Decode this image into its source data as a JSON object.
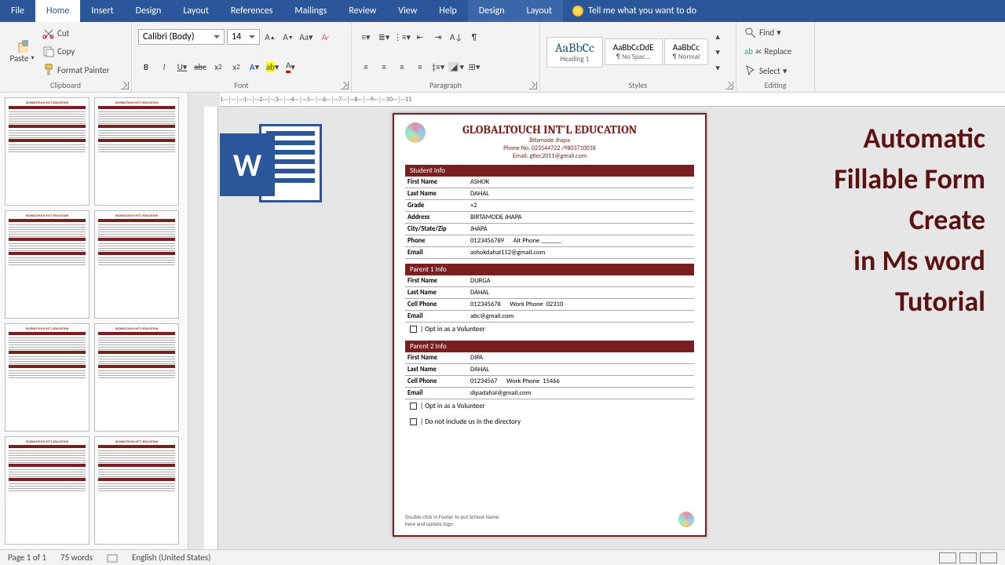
{
  "tabs": [
    "File",
    "Home",
    "Insert",
    "Design",
    "Layout",
    "References",
    "Mailings",
    "Review",
    "View",
    "Help",
    "Design",
    "Layout"
  ],
  "active_tab": "Home",
  "tool_tabs": [
    10,
    11
  ],
  "tellme": "Tell me what you want to do",
  "ribbon": {
    "paste": "Paste",
    "cut": "Cut",
    "copy": "Copy",
    "format_painter": "Format Painter",
    "group_clipboard": "Clipboard",
    "font_name": "Calibri (Body)",
    "font_size": "14",
    "group_font": "Font",
    "group_paragraph": "Paragraph",
    "styles": [
      {
        "sample": "AaBbCc",
        "label": "Heading 1"
      },
      {
        "sample": "AaBbCcDdE",
        "label": "¶ No Spac..."
      },
      {
        "sample": "AaBbCc",
        "label": "¶ Normal"
      }
    ],
    "group_styles": "Styles",
    "find": "Find",
    "replace": "Replace",
    "select": "Select",
    "group_editing": "Editing"
  },
  "ruler": "1···│···│···1···│···2···│···3···│···4···│···5···│···6···│···7···│···8···│···9···│···10···│···11",
  "doc": {
    "title": "GLOBALTOUCH INT'L EDUCATION",
    "sub1": "Bitamode Jhapa",
    "sub2": "Phone No. 023544722 /9803710018",
    "sub3": "Email: gtiec2011@gmail.com",
    "sections": {
      "student": {
        "header": "Student Info",
        "rows": [
          [
            "First Name",
            "ASHOK"
          ],
          [
            "Last Name",
            "DAHAL"
          ],
          [
            "Grade",
            "+2"
          ],
          [
            "Address",
            "BIRTAMODE JHAPA"
          ],
          [
            "City/State/Zip",
            "JHAPA"
          ],
          [
            "Phone",
            "0123456789"
          ],
          [
            "Email",
            "ashokdahal112@gmail.com"
          ]
        ],
        "alt_phone_label": "Alt Phone"
      },
      "parent1": {
        "header": "Parent 1 Info",
        "rows": [
          [
            "First Name",
            "DURGA"
          ],
          [
            "Last Name",
            "DAHAL"
          ],
          [
            "Cell Phone",
            "012345678"
          ],
          [
            "Email",
            "abc@gmail.com"
          ]
        ],
        "work_label": "Work Phone",
        "work_val": "02310",
        "opt": "Opt in as a Volunteer"
      },
      "parent2": {
        "header": "Parent 2 Info",
        "rows": [
          [
            "First Name",
            "DIPA"
          ],
          [
            "Last Name",
            "DAHAL"
          ],
          [
            "Cell Phone",
            "01234567"
          ],
          [
            "Email",
            "dipadahal@gmail.com"
          ]
        ],
        "work_label": "Work Phone",
        "work_val": "15466",
        "opt": "Opt in as a Volunteer"
      },
      "directory": "Do not include us in the directory"
    },
    "footer": "Double click in Footer to put School Name\nhere and update logo"
  },
  "overlay": [
    "Automatic",
    "Fillable Form",
    "Create",
    "in Ms word",
    "Tutorial"
  ],
  "status": {
    "page": "Page 1 of 1",
    "words": "75 words",
    "lang": "English (United States)"
  }
}
